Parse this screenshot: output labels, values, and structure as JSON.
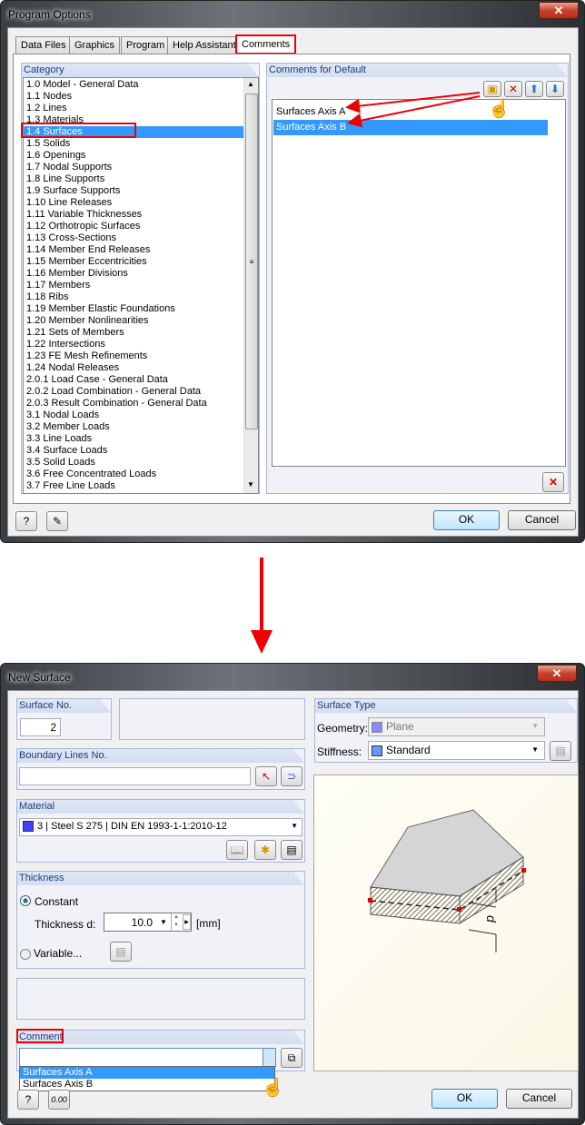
{
  "program_options": {
    "title": "Program Options",
    "tabs": [
      "Data Files",
      "Graphics",
      "Program",
      "Help Assistant",
      "Comments"
    ],
    "active_tab": "Comments",
    "category_label": "Category",
    "categories": [
      "1.0 Model - General Data",
      "1.1 Nodes",
      "1.2 Lines",
      "1.3 Materials",
      "1.4 Surfaces",
      "1.5 Solids",
      "1.6 Openings",
      "1.7 Nodal Supports",
      "1.8 Line Supports",
      "1.9 Surface Supports",
      "1.10 Line Releases",
      "1.11 Variable Thicknesses",
      "1.12 Orthotropic Surfaces",
      "1.13 Cross-Sections",
      "1.14 Member End Releases",
      "1.15 Member Eccentricities",
      "1.16 Member Divisions",
      "1.17 Members",
      "1.18 Ribs",
      "1.19 Member Elastic Foundations",
      "1.20 Member Nonlinearities",
      "1.21 Sets of Members",
      "1.22 Intersections",
      "1.23 FE Mesh Refinements",
      "1.24 Nodal Releases",
      "2.0.1 Load Case - General Data",
      "2.0.2 Load Combination - General Data",
      "2.0.3 Result Combination - General Data",
      "3.1 Nodal Loads",
      "3.2 Member Loads",
      "3.3 Line Loads",
      "3.4 Surface Loads",
      "3.5 Solid Loads",
      "3.6 Free Concentrated Loads",
      "3.7 Free Line Loads"
    ],
    "selected_category": "1.4 Surfaces",
    "comments_label": "Comments for Default",
    "comments": [
      "Surfaces Axis A",
      "Surfaces Axis B"
    ],
    "selected_comment": "Surfaces Axis B",
    "ok": "OK",
    "cancel": "Cancel"
  },
  "new_surface": {
    "title": "New Surface",
    "surface_no_label": "Surface No.",
    "surface_no": "2",
    "boundary_label": "Boundary Lines No.",
    "boundary_value": "",
    "material_label": "Material",
    "material_no": "3",
    "material_name": "Steel S 275",
    "material_std": "DIN EN 1993-1-1:2010-12",
    "material_color": "#4040ff",
    "thickness_label": "Thickness",
    "constant_label": "Constant",
    "thickness_d_label": "Thickness d:",
    "thickness_value": "10.0",
    "unit": "[mm]",
    "variable_label": "Variable...",
    "thickness_mode": "Constant",
    "comment_label": "Comment",
    "comment_value": "",
    "comment_options": [
      "Surfaces Axis A",
      "Surfaces Axis B"
    ],
    "highlighted_option": "Surfaces Axis A",
    "surface_type_label": "Surface Type",
    "geometry_label": "Geometry:",
    "geometry_value": "Plane",
    "geometry_color": "#8888ff",
    "stiffness_label": "Stiffness:",
    "stiffness_value": "Standard",
    "stiffness_color": "#6699ff",
    "preview_dim_label": "d",
    "ok": "OK",
    "cancel": "Cancel"
  },
  "accent": "#3399ff",
  "highlight": "#ee0000"
}
